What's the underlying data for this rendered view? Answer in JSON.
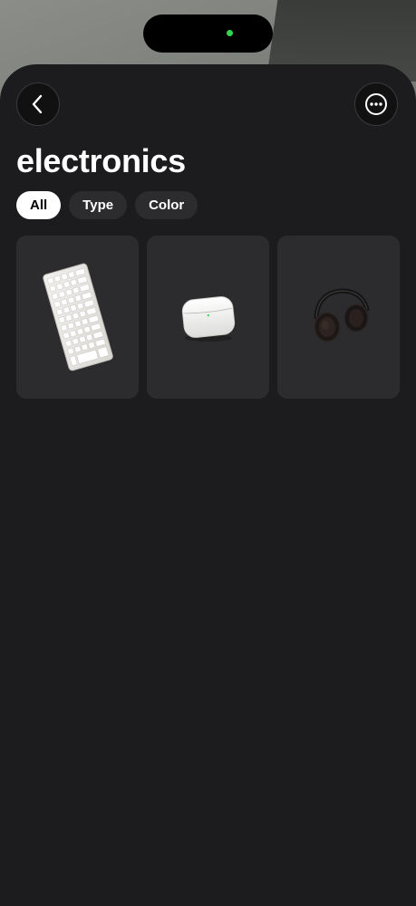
{
  "header": {
    "title": "electronics",
    "back_icon": "chevron-left-icon",
    "more_icon": "ellipsis-circle-icon"
  },
  "filters": [
    {
      "label": "All",
      "selected": true
    },
    {
      "label": "Type",
      "selected": false
    },
    {
      "label": "Color",
      "selected": false
    }
  ],
  "items": [
    {
      "icon": "keyboard-icon"
    },
    {
      "icon": "earbuds-case-icon"
    },
    {
      "icon": "headphones-icon"
    }
  ],
  "colors": {
    "status_dot": "#32d74b",
    "sheet_background": "#1c1c1e",
    "card_background": "#2c2c2e",
    "chip_active": "#ffffff"
  }
}
